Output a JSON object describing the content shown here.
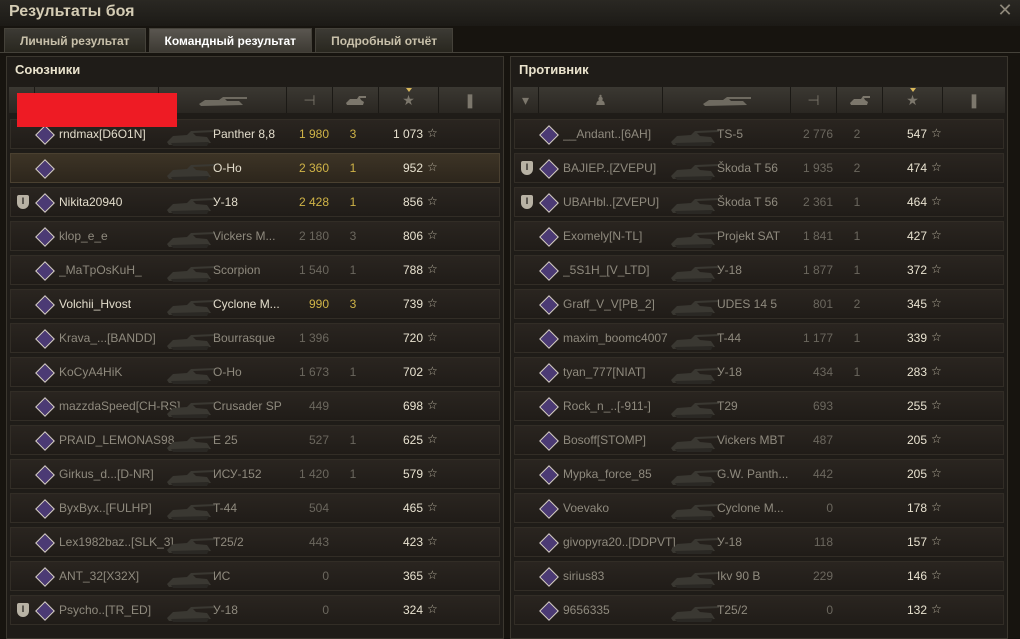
{
  "window": {
    "title": "Результаты боя",
    "close_icon": "close-icon"
  },
  "tabs": [
    {
      "label": "Личный результат",
      "active": false
    },
    {
      "label": "Командный результат",
      "active": true
    },
    {
      "label": "Подробный отчёт",
      "active": false
    }
  ],
  "allies": {
    "title": "Союзники",
    "rows": [
      {
        "player": "rndmax[D6O1N]",
        "vehicle": "Panther 8,8",
        "damage": "1 980",
        "frags": "3",
        "xp": "1 073",
        "platoon": false,
        "self": false,
        "name_color": "white",
        "dmg_color": "yellow"
      },
      {
        "player": "",
        "vehicle": "O-Ho",
        "damage": "2 360",
        "frags": "1",
        "xp": "952",
        "platoon": false,
        "self": true,
        "name_color": "white",
        "dmg_color": "yellow"
      },
      {
        "player": "Nikita20940",
        "vehicle": "У-18",
        "damage": "2 428",
        "frags": "1",
        "xp": "856",
        "platoon": true,
        "self": false,
        "name_color": "white",
        "dmg_color": "yellow"
      },
      {
        "player": "klop_e_e",
        "vehicle": "Vickers M...",
        "damage": "2 180",
        "frags": "3",
        "xp": "806",
        "platoon": false,
        "self": false,
        "name_color": "gray",
        "dmg_color": "dim"
      },
      {
        "player": "_MaTpOsKuH_",
        "vehicle": "Scorpion",
        "damage": "1 540",
        "frags": "1",
        "xp": "788",
        "platoon": false,
        "self": false,
        "name_color": "gray",
        "dmg_color": "dim"
      },
      {
        "player": "Volchii_Hvost",
        "vehicle": "Cyclone M...",
        "damage": "990",
        "frags": "3",
        "xp": "739",
        "platoon": false,
        "self": false,
        "name_color": "white",
        "dmg_color": "yellow"
      },
      {
        "player": "Krava_...[BANDD]",
        "vehicle": "Bourrasque",
        "damage": "1 396",
        "frags": "",
        "xp": "720",
        "platoon": false,
        "self": false,
        "name_color": "gray",
        "dmg_color": "dim"
      },
      {
        "player": "KoCyA4HiK",
        "vehicle": "O-Ho",
        "damage": "1 673",
        "frags": "1",
        "xp": "702",
        "platoon": false,
        "self": false,
        "name_color": "gray",
        "dmg_color": "dim"
      },
      {
        "player": "mazzdaSpeed[CH-RS]",
        "vehicle": "Crusader SP",
        "damage": "449",
        "frags": "",
        "xp": "698",
        "platoon": false,
        "self": false,
        "name_color": "gray",
        "dmg_color": "dim"
      },
      {
        "player": "PRAID_LEMONAS98",
        "vehicle": "E 25",
        "damage": "527",
        "frags": "1",
        "xp": "625",
        "platoon": false,
        "self": false,
        "name_color": "gray",
        "dmg_color": "dim"
      },
      {
        "player": "Girkus_d...[D-NR]",
        "vehicle": "ИСУ-152",
        "damage": "1 420",
        "frags": "1",
        "xp": "579",
        "platoon": false,
        "self": false,
        "name_color": "gray",
        "dmg_color": "dim"
      },
      {
        "player": "ByxByx..[FULHP]",
        "vehicle": "T-44",
        "damage": "504",
        "frags": "",
        "xp": "465",
        "platoon": false,
        "self": false,
        "name_color": "gray",
        "dmg_color": "dim"
      },
      {
        "player": "Lex1982baz..[SLK_3]",
        "vehicle": "T25/2",
        "damage": "443",
        "frags": "",
        "xp": "423",
        "platoon": false,
        "self": false,
        "name_color": "gray",
        "dmg_color": "dim"
      },
      {
        "player": "ANT_32[X32X]",
        "vehicle": "ИС",
        "damage": "0",
        "frags": "",
        "xp": "365",
        "platoon": false,
        "self": false,
        "name_color": "gray",
        "dmg_color": "dim"
      },
      {
        "player": "Psycho..[TR_ED]",
        "vehicle": "У-18",
        "damage": "0",
        "frags": "",
        "xp": "324",
        "platoon": true,
        "self": false,
        "name_color": "gray",
        "dmg_color": "dim"
      }
    ]
  },
  "enemies": {
    "title": "Противник",
    "rows": [
      {
        "player": "__Andant..[6AH]",
        "vehicle": "TS-5",
        "damage": "2 776",
        "frags": "2",
        "xp": "547",
        "platoon": false,
        "name_color": "gray",
        "dmg_color": "dim"
      },
      {
        "player": "BAJIEP..[ZVEPU]",
        "vehicle": "Škoda T 56",
        "damage": "1 935",
        "frags": "2",
        "xp": "474",
        "platoon": true,
        "name_color": "gray",
        "dmg_color": "dim"
      },
      {
        "player": "UBAHbl..[ZVEPU]",
        "vehicle": "Škoda T 56",
        "damage": "2 361",
        "frags": "1",
        "xp": "464",
        "platoon": true,
        "name_color": "gray",
        "dmg_color": "dim"
      },
      {
        "player": "Exomely[N-TL]",
        "vehicle": "Projekt SAT",
        "damage": "1 841",
        "frags": "1",
        "xp": "427",
        "platoon": false,
        "name_color": "gray",
        "dmg_color": "dim"
      },
      {
        "player": "_5S1H_[V_LTD]",
        "vehicle": "У-18",
        "damage": "1 877",
        "frags": "1",
        "xp": "372",
        "platoon": false,
        "name_color": "gray",
        "dmg_color": "dim"
      },
      {
        "player": "Graff_V_V[PB_2]",
        "vehicle": "UDES 14 5",
        "damage": "801",
        "frags": "2",
        "xp": "345",
        "platoon": false,
        "name_color": "gray",
        "dmg_color": "dim"
      },
      {
        "player": "maxim_boomc4007",
        "vehicle": "T-44",
        "damage": "1 177",
        "frags": "1",
        "xp": "339",
        "platoon": false,
        "name_color": "gray",
        "dmg_color": "dim"
      },
      {
        "player": "tyan_777[NIAT]",
        "vehicle": "У-18",
        "damage": "434",
        "frags": "1",
        "xp": "283",
        "platoon": false,
        "name_color": "gray",
        "dmg_color": "dim"
      },
      {
        "player": "Rock_n_..[-911-]",
        "vehicle": "T29",
        "damage": "693",
        "frags": "",
        "xp": "255",
        "platoon": false,
        "name_color": "gray",
        "dmg_color": "dim"
      },
      {
        "player": "Bosoff[STOMP]",
        "vehicle": "Vickers MBT",
        "damage": "487",
        "frags": "",
        "xp": "205",
        "platoon": false,
        "name_color": "gray",
        "dmg_color": "dim"
      },
      {
        "player": "Mypka_force_85",
        "vehicle": "G.W. Panth...",
        "damage": "442",
        "frags": "",
        "xp": "205",
        "platoon": false,
        "name_color": "gray",
        "dmg_color": "dim"
      },
      {
        "player": "Voevako",
        "vehicle": "Cyclone M...",
        "damage": "0",
        "frags": "",
        "xp": "178",
        "platoon": false,
        "name_color": "gray",
        "dmg_color": "dim"
      },
      {
        "player": "givopyra20..[DDPVT]",
        "vehicle": "У-18",
        "damage": "118",
        "frags": "",
        "xp": "157",
        "platoon": false,
        "name_color": "gray",
        "dmg_color": "dim"
      },
      {
        "player": "sirius83",
        "vehicle": "Ikv 90 B",
        "damage": "229",
        "frags": "",
        "xp": "146",
        "platoon": false,
        "name_color": "gray",
        "dmg_color": "dim"
      },
      {
        "player": "9656335",
        "vehicle": "T25/2",
        "damage": "0",
        "frags": "",
        "xp": "132",
        "platoon": false,
        "name_color": "gray",
        "dmg_color": "dim"
      }
    ]
  }
}
